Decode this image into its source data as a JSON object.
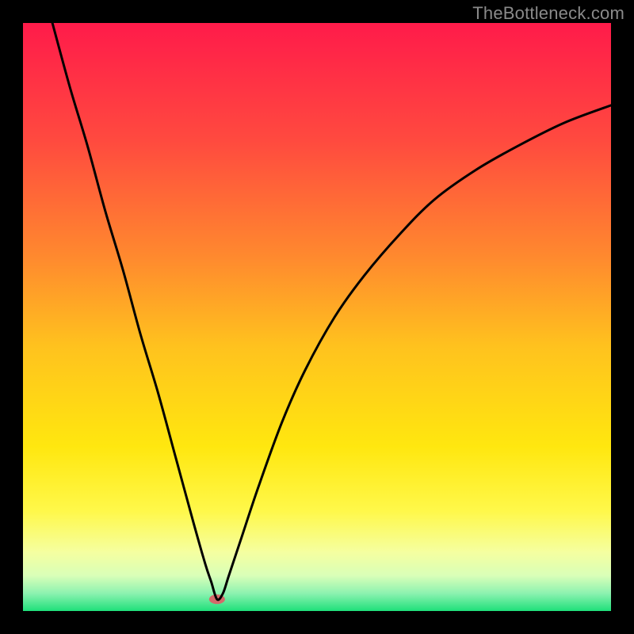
{
  "watermark": "TheBottleneck.com",
  "chart_data": {
    "type": "line",
    "title": "",
    "xlabel": "",
    "ylabel": "",
    "xlim": [
      0,
      100
    ],
    "ylim": [
      0,
      100
    ],
    "axes_visible": false,
    "grid": false,
    "background": {
      "type": "vertical-gradient",
      "stops": [
        {
          "pos": 0.0,
          "color": "#ff1b4a"
        },
        {
          "pos": 0.2,
          "color": "#ff4a3f"
        },
        {
          "pos": 0.4,
          "color": "#ff8a2e"
        },
        {
          "pos": 0.55,
          "color": "#ffc21e"
        },
        {
          "pos": 0.72,
          "color": "#ffe70f"
        },
        {
          "pos": 0.83,
          "color": "#fff84a"
        },
        {
          "pos": 0.9,
          "color": "#f5ffa0"
        },
        {
          "pos": 0.94,
          "color": "#d9ffb8"
        },
        {
          "pos": 0.97,
          "color": "#8cf2b0"
        },
        {
          "pos": 1.0,
          "color": "#1fe07a"
        }
      ]
    },
    "marker": {
      "x": 33,
      "y": 2,
      "color": "#d46a6a",
      "rx": 10,
      "ry": 6
    },
    "series": [
      {
        "name": "curve",
        "color": "#000000",
        "stroke_width": 3,
        "x": [
          5,
          8,
          11,
          14,
          17,
          20,
          23,
          26,
          29,
          31,
          32,
          33,
          34,
          35,
          37,
          40,
          44,
          48,
          53,
          58,
          64,
          70,
          77,
          84,
          92,
          100
        ],
        "y": [
          100,
          89,
          79,
          68,
          58,
          47,
          37,
          26,
          15,
          8,
          5,
          2,
          3,
          6,
          12,
          21,
          32,
          41,
          50,
          57,
          64,
          70,
          75,
          79,
          83,
          86
        ]
      }
    ]
  }
}
